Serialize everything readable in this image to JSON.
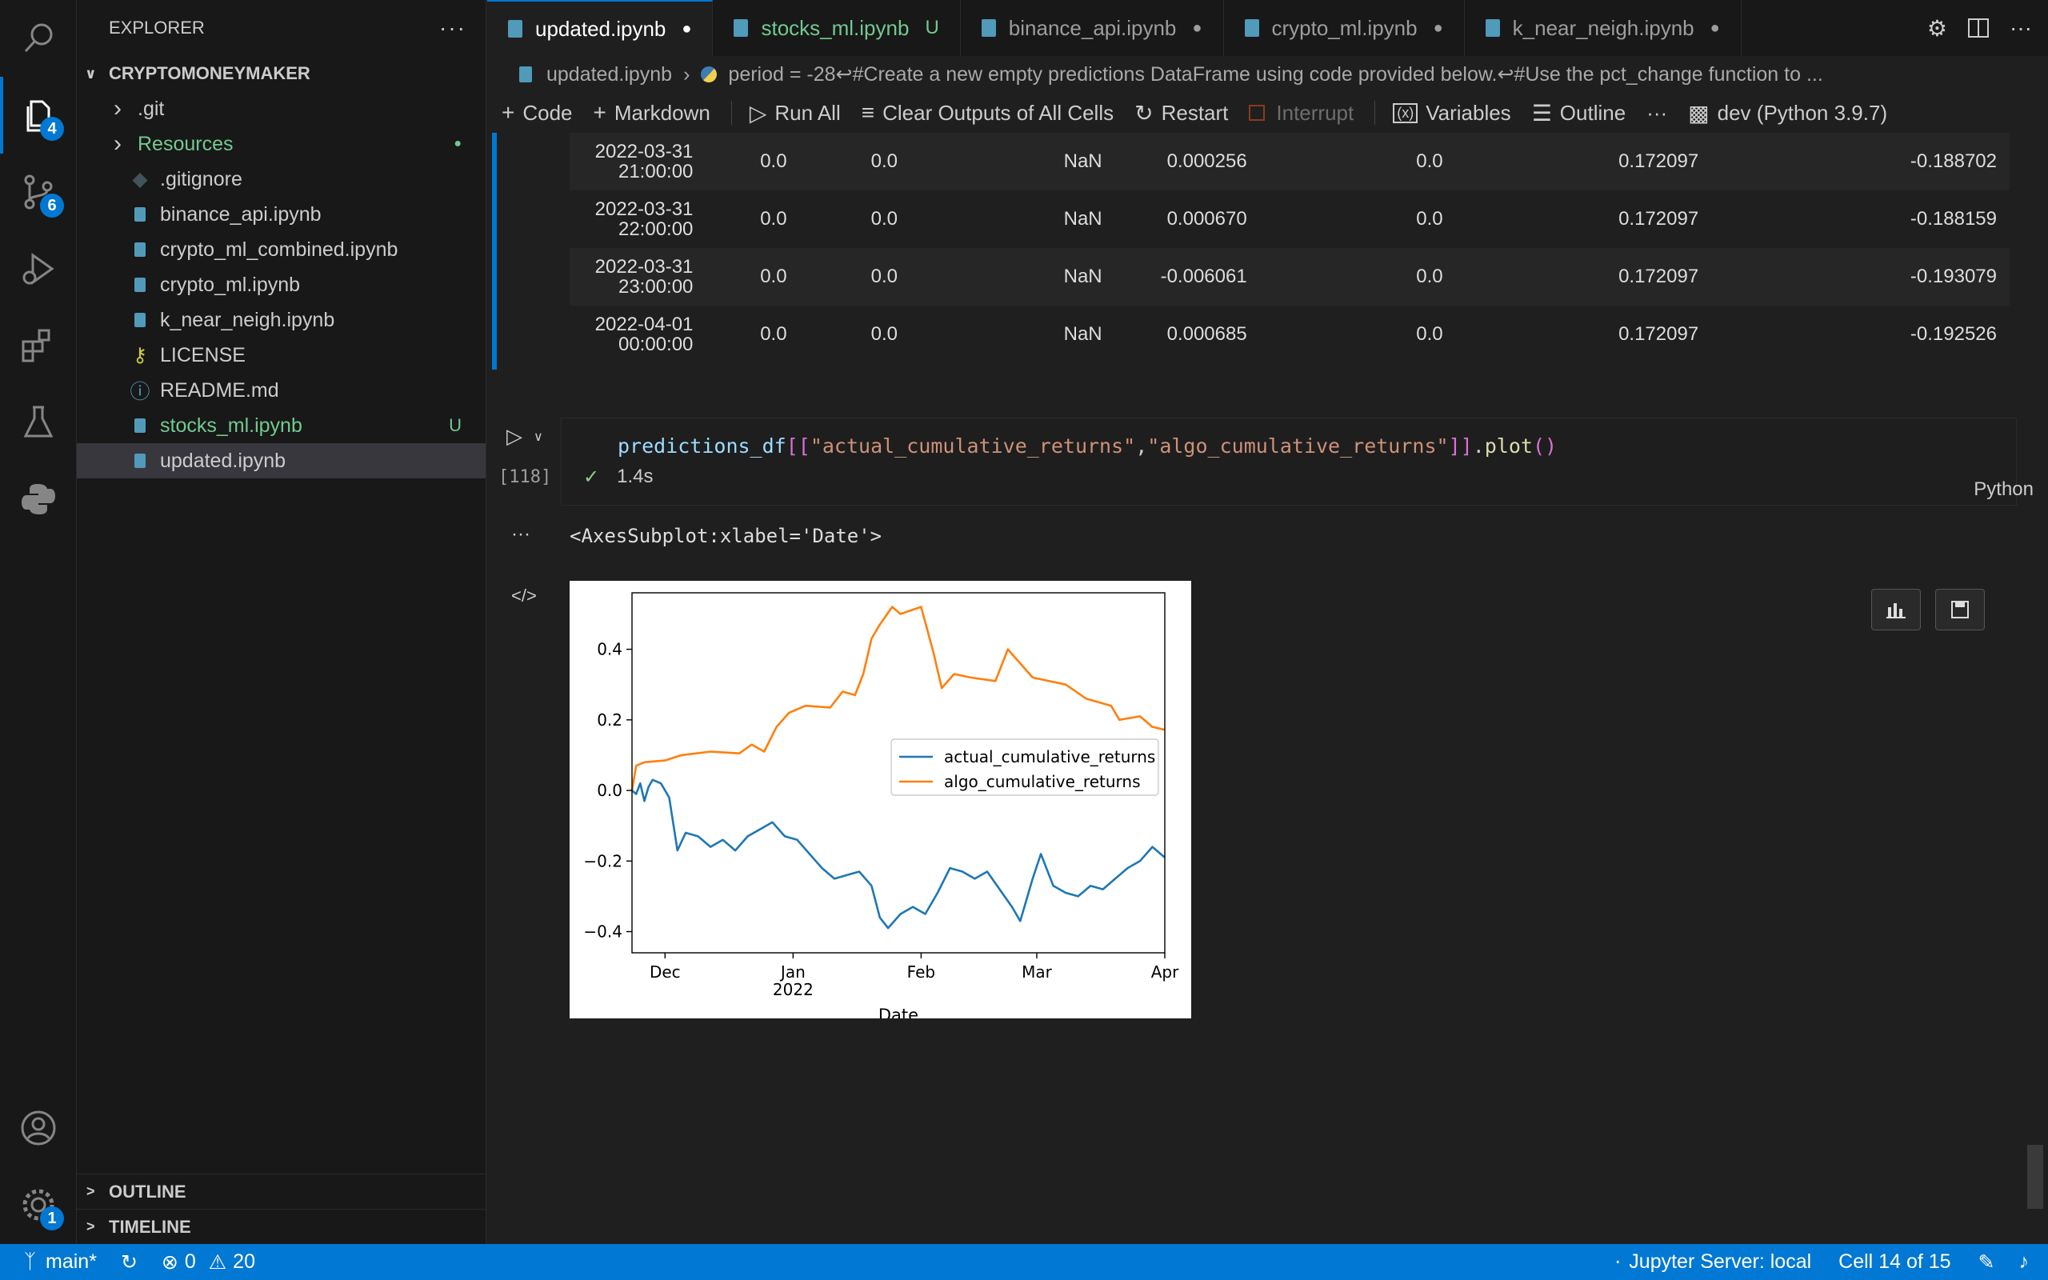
{
  "explorer": {
    "title": "EXPLORER",
    "folder": "CRYPTOMONEYMAKER",
    "items": [
      {
        "label": ".git",
        "kind": "folder",
        "color": "#cccccc",
        "suffix": ""
      },
      {
        "label": "Resources",
        "kind": "folder",
        "color": "#73c991",
        "suffix": "●"
      },
      {
        "label": ".gitignore",
        "kind": "git",
        "color": "#cccccc",
        "suffix": ""
      },
      {
        "label": "binance_api.ipynb",
        "kind": "notebook",
        "color": "#cccccc",
        "suffix": ""
      },
      {
        "label": "crypto_ml_combined.ipynb",
        "kind": "notebook",
        "color": "#cccccc",
        "suffix": ""
      },
      {
        "label": "crypto_ml.ipynb",
        "kind": "notebook",
        "color": "#cccccc",
        "suffix": ""
      },
      {
        "label": "k_near_neigh.ipynb",
        "kind": "notebook",
        "color": "#cccccc",
        "suffix": ""
      },
      {
        "label": "LICENSE",
        "kind": "license",
        "color": "#cccccc",
        "suffix": ""
      },
      {
        "label": "README.md",
        "kind": "info",
        "color": "#cccccc",
        "suffix": ""
      },
      {
        "label": "stocks_ml.ipynb",
        "kind": "notebook",
        "color": "#73c991",
        "suffix": "U"
      },
      {
        "label": "updated.ipynb",
        "kind": "notebook",
        "color": "#cccccc",
        "suffix": ""
      }
    ],
    "outline": "OUTLINE",
    "timeline": "TIMELINE"
  },
  "activity_badges": {
    "explorer": "4",
    "scm": "6",
    "settings": "1"
  },
  "tabs": [
    {
      "label": "updated.ipynb",
      "marker": "●",
      "active": true,
      "color": "#ffffff"
    },
    {
      "label": "stocks_ml.ipynb",
      "marker": "U",
      "active": false,
      "color": "#73c991"
    },
    {
      "label": "binance_api.ipynb",
      "marker": "●",
      "active": false,
      "color": "#9d9d9d"
    },
    {
      "label": "crypto_ml.ipynb",
      "marker": "●",
      "active": false,
      "color": "#9d9d9d"
    },
    {
      "label": "k_near_neigh.ipynb",
      "marker": "●",
      "active": false,
      "color": "#9d9d9d"
    }
  ],
  "breadcrumb": {
    "file": "updated.ipynb",
    "cell": "period = -28↩#Create a new empty predictions DataFrame using code provided below.↩#Use the pct_change function to ..."
  },
  "toolbar": {
    "code": "Code",
    "markdown": "Markdown",
    "run_all": "Run All",
    "clear": "Clear Outputs of All Cells",
    "restart": "Restart",
    "interrupt": "Interrupt",
    "variables": "Variables",
    "outline": "Outline",
    "more": "···",
    "kernel": "dev (Python 3.9.7)"
  },
  "table_rows": [
    {
      "date": "2022-03-31",
      "time": "21:00:00",
      "c1": "0.0",
      "c2": "0.0",
      "c3": "NaN",
      "c4": "0.000256",
      "c5": "0.0",
      "c6": "0.172097",
      "c7": "-0.188702"
    },
    {
      "date": "2022-03-31",
      "time": "22:00:00",
      "c1": "0.0",
      "c2": "0.0",
      "c3": "NaN",
      "c4": "0.000670",
      "c5": "0.0",
      "c6": "0.172097",
      "c7": "-0.188159"
    },
    {
      "date": "2022-03-31",
      "time": "23:00:00",
      "c1": "0.0",
      "c2": "0.0",
      "c3": "NaN",
      "c4": "-0.006061",
      "c5": "0.0",
      "c6": "0.172097",
      "c7": "-0.193079"
    },
    {
      "date": "2022-04-01",
      "time": "00:00:00",
      "c1": "0.0",
      "c2": "0.0",
      "c3": "NaN",
      "c4": "0.000685",
      "c5": "0.0",
      "c6": "0.172097",
      "c7": "-0.192526"
    }
  ],
  "cell": {
    "tokens": [
      {
        "t": "predictions_df",
        "c": "tok-var"
      },
      {
        "t": "[[",
        "c": "tok-br"
      },
      {
        "t": "\"actual_cumulative_returns\"",
        "c": "tok-str"
      },
      {
        "t": ",",
        "c": "tok-pun"
      },
      {
        "t": "\"algo_cumulative_returns\"",
        "c": "tok-str"
      },
      {
        "t": "]]",
        "c": "tok-br"
      },
      {
        "t": ".",
        "c": "tok-pun"
      },
      {
        "t": "plot",
        "c": "tok-fn"
      },
      {
        "t": "()",
        "c": "tok-br"
      }
    ],
    "exec_count": "[118]",
    "duration": "1.4s",
    "language": "Python",
    "output_text": "<AxesSubplot:xlabel='Date'>",
    "output_dots": "···"
  },
  "chart_data": {
    "type": "line",
    "xlabel": "Date",
    "ylabel": "",
    "xlim": [
      "2021-11-23",
      "2022-04-01"
    ],
    "ylim": [
      -0.46,
      0.56
    ],
    "yticks": [
      -0.4,
      -0.2,
      0.0,
      0.2,
      0.4
    ],
    "ytick_labels": [
      "−0.4",
      "−0.2",
      "0.0",
      "0.2",
      "0.4"
    ],
    "xticks": [
      {
        "date": "2021-12-01",
        "label": "Dec",
        "sub": ""
      },
      {
        "date": "2022-01-01",
        "label": "Jan",
        "sub": "2022"
      },
      {
        "date": "2022-02-01",
        "label": "Feb",
        "sub": ""
      },
      {
        "date": "2022-03-01",
        "label": "Mar",
        "sub": ""
      },
      {
        "date": "2022-04-01",
        "label": "Apr",
        "sub": ""
      }
    ],
    "legend_position": "center-right",
    "grid": false,
    "series": [
      {
        "name": "actual_cumulative_returns",
        "color": "#1f77b4",
        "points": [
          [
            "2021-11-23",
            0.0
          ],
          [
            "2021-11-24",
            -0.01
          ],
          [
            "2021-11-25",
            0.02
          ],
          [
            "2021-11-26",
            -0.03
          ],
          [
            "2021-11-27",
            0.01
          ],
          [
            "2021-11-28",
            0.03
          ],
          [
            "2021-11-30",
            0.02
          ],
          [
            "2021-12-02",
            -0.02
          ],
          [
            "2021-12-04",
            -0.17
          ],
          [
            "2021-12-06",
            -0.12
          ],
          [
            "2021-12-09",
            -0.13
          ],
          [
            "2021-12-12",
            -0.16
          ],
          [
            "2021-12-15",
            -0.14
          ],
          [
            "2021-12-18",
            -0.17
          ],
          [
            "2021-12-21",
            -0.13
          ],
          [
            "2021-12-24",
            -0.11
          ],
          [
            "2021-12-27",
            -0.09
          ],
          [
            "2021-12-30",
            -0.13
          ],
          [
            "2022-01-02",
            -0.14
          ],
          [
            "2022-01-05",
            -0.18
          ],
          [
            "2022-01-08",
            -0.22
          ],
          [
            "2022-01-11",
            -0.25
          ],
          [
            "2022-01-14",
            -0.24
          ],
          [
            "2022-01-17",
            -0.23
          ],
          [
            "2022-01-20",
            -0.27
          ],
          [
            "2022-01-22",
            -0.36
          ],
          [
            "2022-01-24",
            -0.39
          ],
          [
            "2022-01-27",
            -0.35
          ],
          [
            "2022-01-30",
            -0.33
          ],
          [
            "2022-02-02",
            -0.35
          ],
          [
            "2022-02-05",
            -0.29
          ],
          [
            "2022-02-08",
            -0.22
          ],
          [
            "2022-02-11",
            -0.23
          ],
          [
            "2022-02-14",
            -0.25
          ],
          [
            "2022-02-17",
            -0.23
          ],
          [
            "2022-02-20",
            -0.28
          ],
          [
            "2022-02-23",
            -0.33
          ],
          [
            "2022-02-25",
            -0.37
          ],
          [
            "2022-02-28",
            -0.25
          ],
          [
            "2022-03-02",
            -0.18
          ],
          [
            "2022-03-05",
            -0.27
          ],
          [
            "2022-03-08",
            -0.29
          ],
          [
            "2022-03-11",
            -0.3
          ],
          [
            "2022-03-14",
            -0.27
          ],
          [
            "2022-03-17",
            -0.28
          ],
          [
            "2022-03-20",
            -0.25
          ],
          [
            "2022-03-23",
            -0.22
          ],
          [
            "2022-03-26",
            -0.2
          ],
          [
            "2022-03-29",
            -0.16
          ],
          [
            "2022-04-01",
            -0.19
          ]
        ]
      },
      {
        "name": "algo_cumulative_returns",
        "color": "#ff7f0e",
        "points": [
          [
            "2021-11-23",
            0.0
          ],
          [
            "2021-11-24",
            0.07
          ],
          [
            "2021-11-26",
            0.08
          ],
          [
            "2021-12-01",
            0.085
          ],
          [
            "2021-12-05",
            0.1
          ],
          [
            "2021-12-12",
            0.11
          ],
          [
            "2021-12-19",
            0.105
          ],
          [
            "2021-12-22",
            0.13
          ],
          [
            "2021-12-25",
            0.11
          ],
          [
            "2021-12-28",
            0.18
          ],
          [
            "2021-12-31",
            0.22
          ],
          [
            "2022-01-04",
            0.24
          ],
          [
            "2022-01-10",
            0.235
          ],
          [
            "2022-01-13",
            0.28
          ],
          [
            "2022-01-16",
            0.27
          ],
          [
            "2022-01-18",
            0.33
          ],
          [
            "2022-01-20",
            0.43
          ],
          [
            "2022-01-22",
            0.47
          ],
          [
            "2022-01-25",
            0.52
          ],
          [
            "2022-01-27",
            0.5
          ],
          [
            "2022-02-01",
            0.52
          ],
          [
            "2022-02-04",
            0.39
          ],
          [
            "2022-02-06",
            0.29
          ],
          [
            "2022-02-09",
            0.33
          ],
          [
            "2022-02-13",
            0.32
          ],
          [
            "2022-02-19",
            0.31
          ],
          [
            "2022-02-22",
            0.4
          ],
          [
            "2022-02-28",
            0.32
          ],
          [
            "2022-03-08",
            0.3
          ],
          [
            "2022-03-13",
            0.26
          ],
          [
            "2022-03-19",
            0.24
          ],
          [
            "2022-03-21",
            0.2
          ],
          [
            "2022-03-26",
            0.21
          ],
          [
            "2022-03-29",
            0.18
          ],
          [
            "2022-04-01",
            0.172
          ]
        ]
      }
    ]
  },
  "status": {
    "branch": "main*",
    "errors": "0",
    "warnings": "20",
    "jupyter": "Jupyter Server: local",
    "cell_pos": "Cell 14 of 15"
  }
}
